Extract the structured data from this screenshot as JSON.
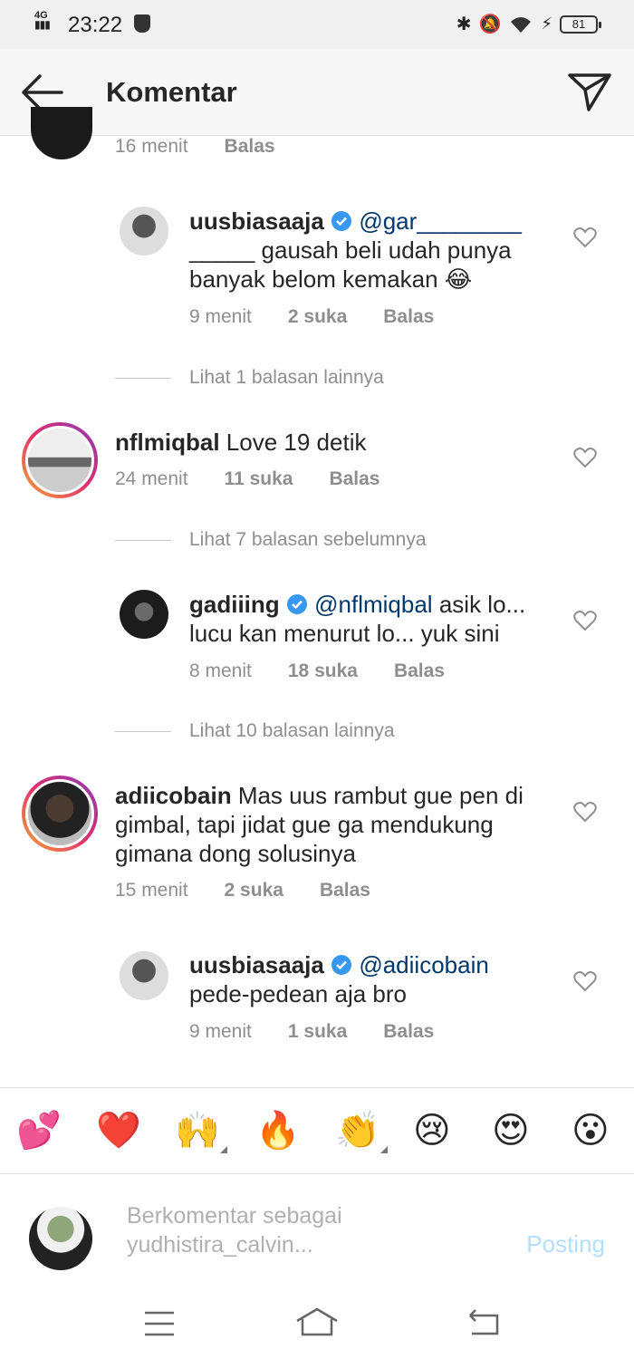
{
  "status_bar": {
    "network": "4G",
    "time": "23:22",
    "battery": "81"
  },
  "header": {
    "title": "Komentar"
  },
  "comments": [
    {
      "time": "16 menit",
      "reply": "Balas"
    },
    {
      "user": "uusbiasaaja",
      "mention": "@gar________",
      "text_l1": "_____ gausah beli udah punya",
      "text_l2": "banyak belom kemakan 😂",
      "time": "9 menit",
      "likes": "2 suka",
      "reply": "Balas"
    },
    {
      "user": "nflmiqbal",
      "text": "Love 19 detik",
      "time": "24 menit",
      "likes": "11 suka",
      "reply": "Balas"
    },
    {
      "user": "gadiiing",
      "mention": "@nflmiqbal",
      "text_l1": "asik lo...",
      "text_l2": "lucu kan menurut lo... yuk sini",
      "time": "8 menit",
      "likes": "18 suka",
      "reply": "Balas"
    },
    {
      "user": "adiicobain",
      "text_l1": "Mas uus rambut gue pen di",
      "text_l2": "gimbal, tapi jidat gue ga mendukung",
      "text_l3": "gimana dong solusinya",
      "time": "15 menit",
      "likes": "2 suka",
      "reply": "Balas"
    },
    {
      "user": "uusbiasaaja",
      "mention": "@adiicobain",
      "text_l2": "pede-pedean aja bro",
      "time": "9 menit",
      "likes": "1 suka",
      "reply": "Balas"
    }
  ],
  "more_replies": [
    "Lihat 1 balasan lainnya",
    "Lihat 7 balasan sebelumnya",
    "Lihat 10 balasan lainnya"
  ],
  "emojis": [
    "💕",
    "❤️",
    "🙌",
    "🔥",
    "👏",
    "😢",
    "😍",
    "😮"
  ],
  "composer": {
    "placeholder_l1": "Berkomentar sebagai",
    "placeholder_l2": "yudhistira_calvin...",
    "post_label": "Posting"
  },
  "colors": {
    "accent_blue": "#3897f0",
    "post_disabled": "#b2dffc",
    "muted": "#8e8e8e"
  }
}
